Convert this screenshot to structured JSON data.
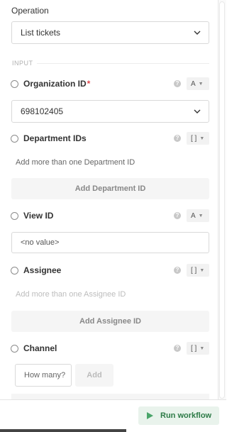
{
  "operation": {
    "label": "Operation",
    "value": "List tickets"
  },
  "section": {
    "input_label": "INPUT"
  },
  "fields": {
    "organization_id": {
      "label": "Organization ID",
      "required_mark": "*",
      "type_glyph": "A",
      "value": "698102405"
    },
    "department_ids": {
      "label": "Department IDs",
      "type_glyph": "[ ]",
      "hint": "Add more than one Department ID",
      "add_label": "Add Department ID"
    },
    "view_id": {
      "label": "View ID",
      "type_glyph": "A",
      "value": "<no value>"
    },
    "assignee": {
      "label": "Assignee",
      "type_glyph": "[ ]",
      "hint": "Add more than one Assignee ID",
      "add_label": "Add Assignee ID"
    },
    "channel": {
      "label": "Channel",
      "type_glyph": "[ ]",
      "input_value": "How many?",
      "add_label": "Add"
    }
  },
  "help_glyph": "?",
  "footer": {
    "run_label": "Run workflow"
  },
  "colors": {
    "accent_green": "#4aa56a",
    "required_red": "#e0484e",
    "border": "#d9d9d9"
  },
  "icons": {
    "dropdown": "chevron-down-icon",
    "run": "play-icon",
    "help": "help-circle-icon"
  }
}
